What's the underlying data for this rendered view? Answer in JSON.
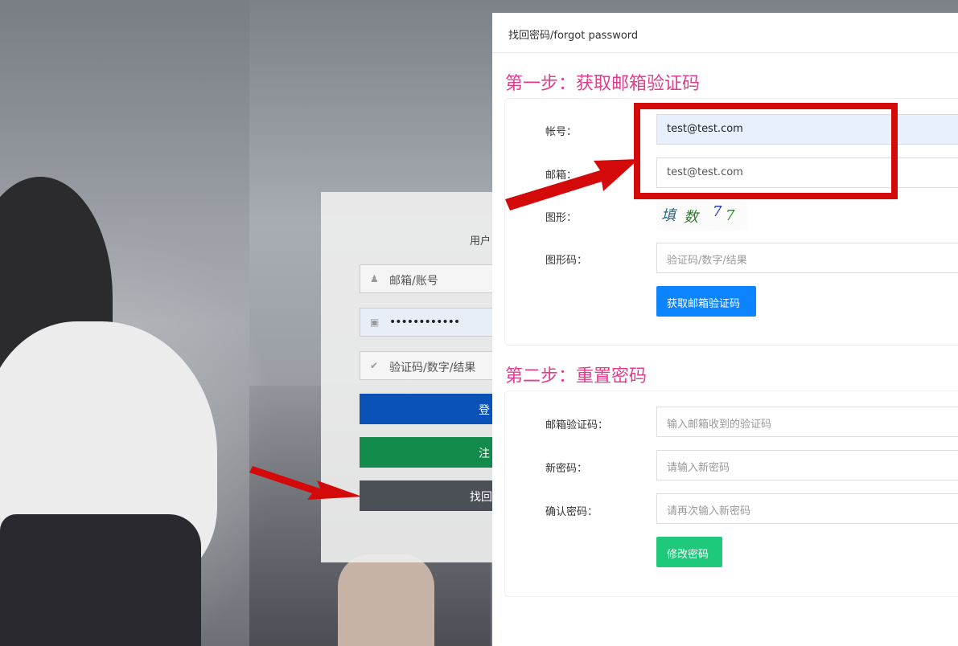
{
  "login": {
    "user_tab": "用户",
    "email_placeholder": "邮箱/账号",
    "password_value": "••••••••••••",
    "captcha_placeholder": "验证码/数字/结果",
    "login_label": "登",
    "register_label": "注",
    "forgot_label": "找回"
  },
  "modal": {
    "title": "找回密码/forgot password",
    "step1_title": "第一步：获取邮箱验证码",
    "step2_title": "第二步：重置密码",
    "account_label": "帐号：",
    "account_value": "test@test.com",
    "email_label": "邮箱：",
    "email_value": "test@test.com",
    "captcha_image_label": "图形：",
    "captcha_chars": [
      "填",
      "数",
      "7",
      "7"
    ],
    "captcha_code_label": "图形码：",
    "captcha_code_placeholder": "验证码/数字/结果",
    "get_code_button": "获取邮箱验证码",
    "email_code_label": "邮箱验证码：",
    "email_code_placeholder": "输入邮箱收到的验证码",
    "new_password_label": "新密码：",
    "new_password_placeholder": "请输入新密码",
    "confirm_password_label": "确认密码：",
    "confirm_password_placeholder": "请再次输入新密码",
    "change_password_button": "修改密码"
  },
  "colors": {
    "step_title": "#e23c8c",
    "primary": "#0d84ff",
    "success": "#1fc97b",
    "annotation": "#d40a0a",
    "login_button": "#0b52b8",
    "register_button": "#128a4a",
    "forgot_button": "#4b4f56"
  },
  "icons": [
    "user-icon",
    "lock-icon",
    "check-icon"
  ]
}
